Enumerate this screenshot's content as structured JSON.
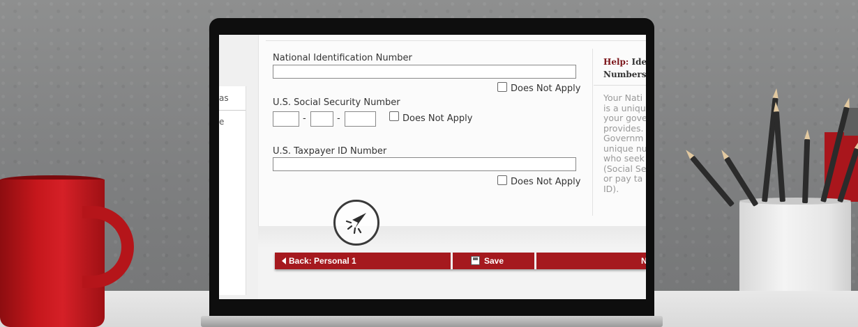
{
  "form": {
    "national_id": {
      "label": "National Identification Number",
      "value": "",
      "does_not_apply_label": "Does Not Apply"
    },
    "ssn": {
      "label": "U.S. Social Security Number",
      "part1": "",
      "separator1": "-",
      "part2": "",
      "separator2": "-",
      "part3": "",
      "does_not_apply_label": "Does Not Apply"
    },
    "taxpayer_id": {
      "label": "U.S. Taxpayer ID Number",
      "value": "",
      "does_not_apply_label": "Does Not Apply"
    }
  },
  "left_panel": {
    "item1": "as",
    "item2": "e"
  },
  "help": {
    "prefix": "Help:",
    "title_line1": "Ide",
    "title_line2": "Numbers",
    "lines": [
      "Your Nati",
      "is a uniqu",
      "your gove",
      "provides.",
      "Governm",
      "unique nu",
      "who seek",
      "(Social Se",
      "or pay ta",
      "ID)."
    ]
  },
  "navigation": {
    "back_label": "Back: Personal 1",
    "save_label": "Save",
    "next_label": "N"
  },
  "colors": {
    "accent": "#a5191e",
    "help_title": "#7b1419"
  },
  "icons": {
    "back": "triangle-left",
    "save": "floppy-disk",
    "cursor": "click-pointer"
  }
}
